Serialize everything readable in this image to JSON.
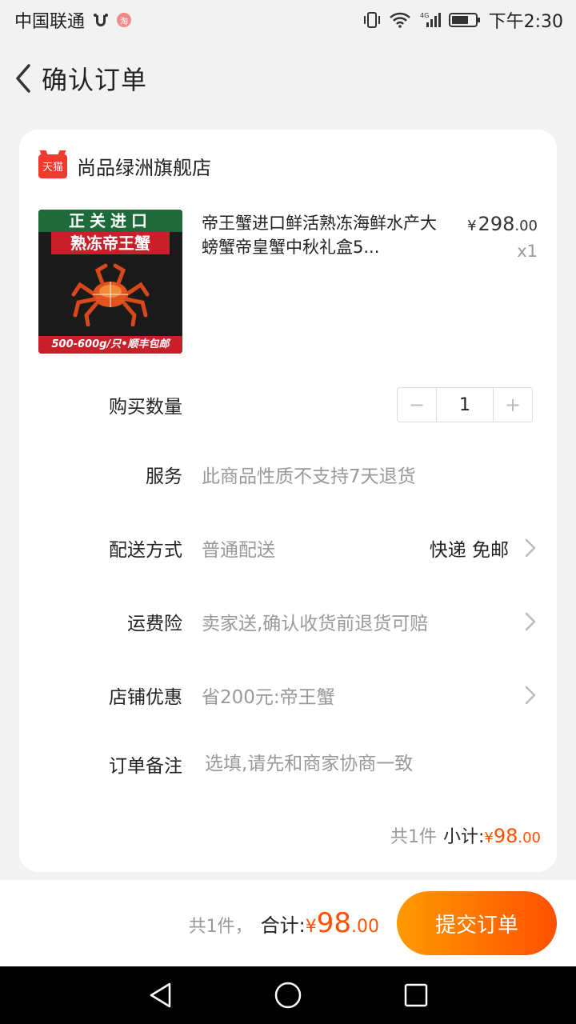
{
  "status_bar": {
    "carrier": "中国联通",
    "time": "下午2:30",
    "network": "4G"
  },
  "header": {
    "title": "确认订单"
  },
  "shop": {
    "logo_text": "天猫",
    "name": "尚品绿洲旗舰店"
  },
  "product": {
    "image_banner_top": "正关进口",
    "image_banner_title": "熟冻帝王蟹",
    "image_footer": "500-600g/只•顺丰包邮",
    "title": "帝王蟹进口鲜活熟冻海鲜水产大螃蟹帝皇蟹中秋礼盒5...",
    "price_symbol": "¥",
    "price_int": "298",
    "price_dec": ".00",
    "quantity": "x1"
  },
  "form": {
    "quantity_label": "购买数量",
    "quantity_value": "1",
    "minus": "−",
    "plus": "+",
    "service_label": "服务",
    "service_value": "此商品性质不支持7天退货",
    "delivery_label": "配送方式",
    "delivery_value": "普通配送",
    "delivery_right": "快递 免邮",
    "insurance_label": "运费险",
    "insurance_value": "卖家送,确认收货前退货可赔",
    "discount_label": "店铺优惠",
    "discount_value": "省200元:帝王蟹",
    "note_label": "订单备注",
    "note_placeholder": "选填,请先和商家协商一致"
  },
  "subtotal": {
    "count": "共1件",
    "label": "小计:",
    "symbol": "¥",
    "int": "98",
    "dec": ".00"
  },
  "bottom": {
    "count": "共1件，",
    "label": "合计:",
    "symbol": "¥",
    "int": "98",
    "dec": ".00",
    "submit": "提交订单"
  },
  "colors": {
    "accent": "#ff5000",
    "gradient_start": "#ff9a00",
    "tmall_red": "#ef3a2d"
  }
}
